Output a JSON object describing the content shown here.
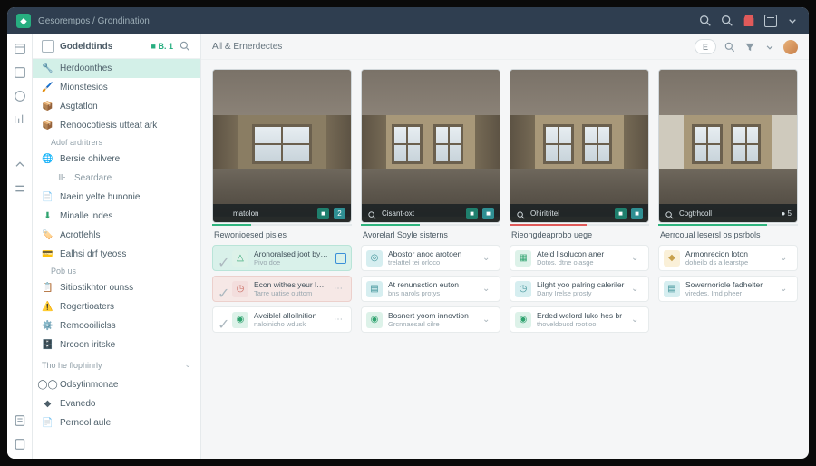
{
  "topbar": {
    "breadcrumb": "Gesorempos / Grondination"
  },
  "sidebar": {
    "header": {
      "title": "Godeldtinds",
      "badge": "■ B. 1"
    },
    "items": [
      {
        "label": "Herdoonthes",
        "active": true
      },
      {
        "label": "Mionstesios"
      },
      {
        "label": "Asgtatlon"
      },
      {
        "label": "Renoocotiesis utteat ark"
      }
    ],
    "sub1": "Adof ardritrers",
    "items2": [
      {
        "label": "Bersie ohilvere"
      },
      {
        "label": "Seardare",
        "sub": true
      },
      {
        "label": "Naein yelte hunonie"
      }
    ],
    "items3": [
      {
        "label": "Minalle indes"
      },
      {
        "label": "Acrotfehls"
      },
      {
        "label": "Ealhsi drf tyeoss"
      }
    ],
    "sub2": "Pob us",
    "items4": [
      {
        "label": "Sitiostikhtor ounss"
      },
      {
        "label": "Rogertioaters"
      },
      {
        "label": "Remoooiliclss"
      },
      {
        "label": "Nrcoon iritske"
      }
    ],
    "section": "Tho he flophinrly",
    "items5": [
      {
        "label": "Odsytinmonae"
      },
      {
        "label": "Evanedo"
      },
      {
        "label": "Pernool aule"
      }
    ]
  },
  "main": {
    "title": "All & Ernerdectes",
    "filter": "E"
  },
  "cards": [
    {
      "thumb_label": "matolon",
      "badges": [
        "■",
        "2"
      ],
      "title": "Rewonioesed pisles",
      "items": [
        {
          "t1": "Aronoralsed joot bytvhes",
          "t2": "Pivo doe",
          "ico": "ii-g",
          "hl": "hl",
          "sq": true
        },
        {
          "t1": "Econ withes yeur lapaled",
          "t2": "Tarre uatise outtom",
          "ico": "ii-r",
          "hl": "hl2"
        },
        {
          "t1": "Aveiblel alloilnition",
          "t2": "naloinicho wdusk",
          "ico": "ii-g"
        }
      ]
    },
    {
      "thumb_label": "Cisant-oxt",
      "title": "Avorelarl Soyle sisterns",
      "items": [
        {
          "t1": "Abostor anoc arotoen",
          "t2": "trelattel tei orloco",
          "ico": "ii-t"
        },
        {
          "t1": "At renunsction euton",
          "t2": "bns narols protys",
          "ico": "ii-t"
        },
        {
          "t1": "Bosnert yoom innovtion",
          "t2": "Grcnnaesarl cilre",
          "ico": "ii-g"
        }
      ]
    },
    {
      "thumb_label": "Ohiritritei",
      "title": "Rieongdeaprobo uege",
      "items": [
        {
          "t1": "Ateld lisolucon aner",
          "t2": "Dotos. dtne olasge",
          "ico": "ii-g"
        },
        {
          "t1": "Lilght yoo palring caleriler",
          "t2": "Dany Irelse prosty",
          "ico": "ii-t"
        },
        {
          "t1": "Erded welord luko hes br",
          "t2": "thoveldoucd rootloo",
          "ico": "ii-g"
        }
      ]
    },
    {
      "thumb_label": "Cogtrhcoll",
      "count": "● 5",
      "title": "Aerrcoual lesersl os psrbols",
      "items": [
        {
          "t1": "Armonrecion loton",
          "t2": "doheilo ds a learstpe",
          "ico": "ii-y"
        },
        {
          "t1": "Sowernoriole fadhelter",
          "t2": "viredes. Imd pheer",
          "ico": "ii-t"
        }
      ]
    }
  ]
}
